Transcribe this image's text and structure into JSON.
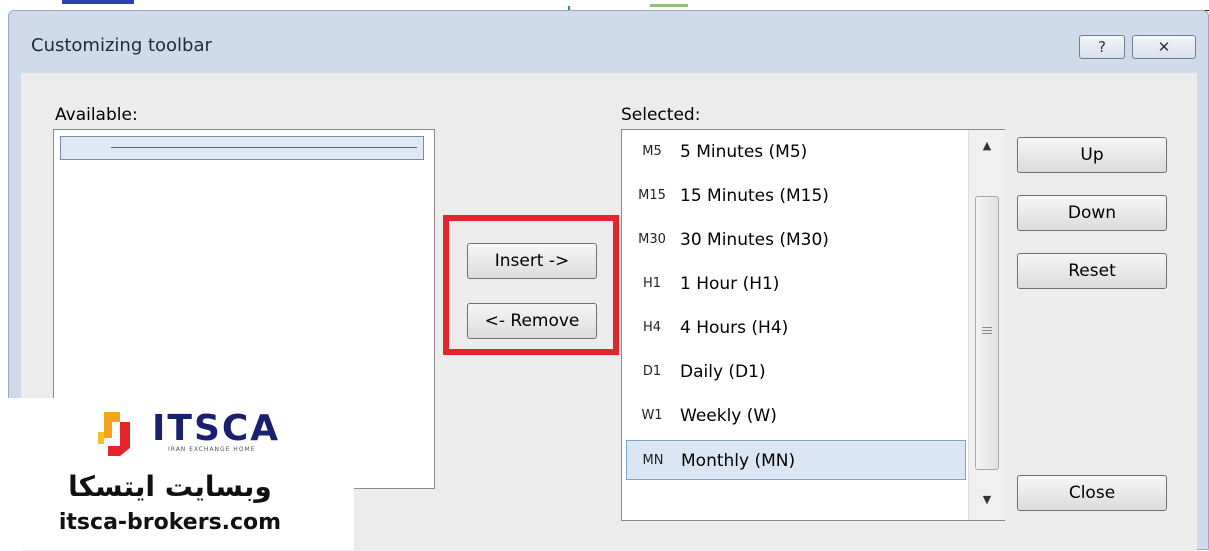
{
  "dialog": {
    "title": "Customizing toolbar",
    "help_glyph": "?",
    "close_glyph": "✕"
  },
  "available": {
    "label": "Available:"
  },
  "actions": {
    "insert_label": "Insert ->",
    "remove_label": "<- Remove"
  },
  "selected": {
    "label": "Selected:",
    "items": [
      {
        "code": "M5",
        "name": "5 Minutes (M5)"
      },
      {
        "code": "M15",
        "name": "15 Minutes (M15)"
      },
      {
        "code": "M30",
        "name": "30 Minutes (M30)"
      },
      {
        "code": "H1",
        "name": "1 Hour (H1)"
      },
      {
        "code": "H4",
        "name": "4 Hours (H4)"
      },
      {
        "code": "D1",
        "name": "Daily (D1)"
      },
      {
        "code": "W1",
        "name": "Weekly (W)"
      },
      {
        "code": "MN",
        "name": "Monthly (MN)"
      }
    ],
    "selected_index": 7
  },
  "side_buttons": {
    "up_label": "Up",
    "down_label": "Down",
    "reset_label": "Reset",
    "close_label": "Close"
  },
  "watermark": {
    "logo_text": "ITSCA",
    "logo_subtext": "IRAN EXCHANGE HOME",
    "site_name_fa": "وبسایت ایتسکا",
    "site_url": "itsca-brokers.com"
  },
  "colors": {
    "highlight": "#e3242b",
    "selection": "#dbe6f4",
    "titlebar": "#cfdaea"
  }
}
